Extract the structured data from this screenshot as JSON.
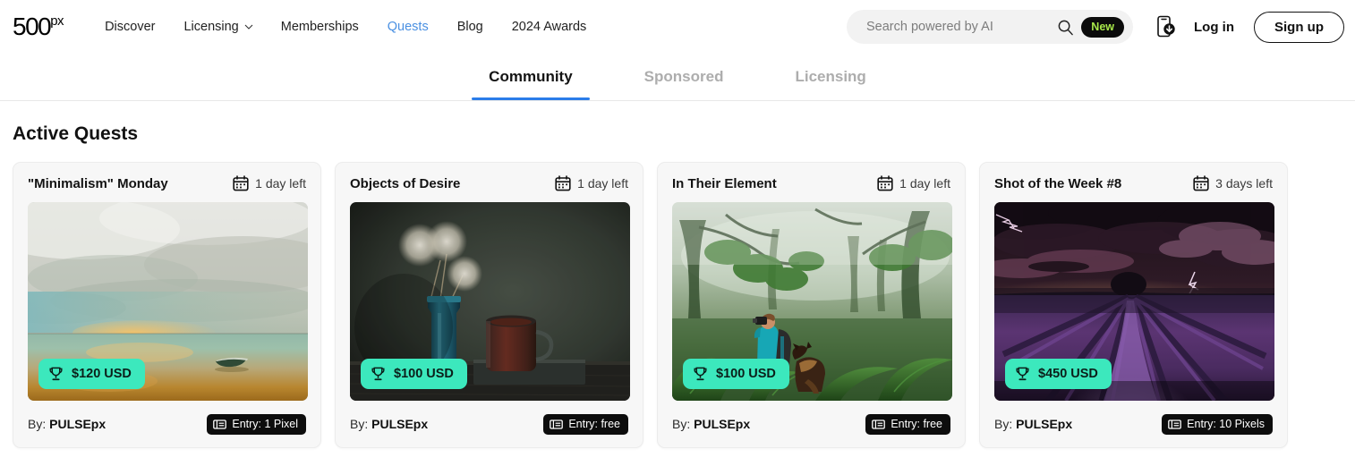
{
  "header": {
    "logo": {
      "num": "500",
      "px": "px"
    },
    "nav": [
      {
        "label": "Discover",
        "active": false,
        "caret": false
      },
      {
        "label": "Licensing",
        "active": false,
        "caret": true
      },
      {
        "label": "Memberships",
        "active": false,
        "caret": false
      },
      {
        "label": "Quests",
        "active": true,
        "caret": false
      },
      {
        "label": "Blog",
        "active": false,
        "caret": false
      },
      {
        "label": "2024 Awards",
        "active": false,
        "caret": false
      }
    ],
    "search": {
      "placeholder": "Search powered by AI",
      "value": "",
      "icon": "search-icon"
    },
    "new_badge": "New",
    "app_icon": "mobile-download-icon",
    "login_label": "Log in",
    "signup_label": "Sign up",
    "accent_blue": "#4a90e2",
    "new_badge_green": "#a8e84a"
  },
  "tabs": [
    {
      "label": "Community",
      "active": true
    },
    {
      "label": "Sponsored",
      "active": false
    },
    {
      "label": "Licensing",
      "active": false
    }
  ],
  "tab_underline_color": "#2b7de9",
  "section": {
    "title": "Active Quests"
  },
  "prize_badge_color": "#3ce8bd",
  "cards": [
    {
      "title": "\"Minimalism\" Monday",
      "days_left": "1 day left",
      "prize": "$120 USD",
      "by_label": "By:",
      "author": "PULSEpx",
      "entry": "Entry: 1 Pixel",
      "photo_alt": "minimalist-seascape-boat"
    },
    {
      "title": "Objects of Desire",
      "days_left": "1 day left",
      "prize": "$100 USD",
      "by_label": "By:",
      "author": "PULSEpx",
      "entry": "Entry: free",
      "photo_alt": "dark-still-life-dandelions-mug"
    },
    {
      "title": "In Their Element",
      "days_left": "1 day left",
      "prize": "$100 USD",
      "by_label": "By:",
      "author": "PULSEpx",
      "entry": "Entry: free",
      "photo_alt": "misty-forest-photographer-dog"
    },
    {
      "title": "Shot of the Week #8",
      "days_left": "3 days left",
      "prize": "$450 USD",
      "by_label": "By:",
      "author": "PULSEpx",
      "entry": "Entry: 10 Pixels",
      "photo_alt": "lavender-field-lightning-storm"
    }
  ]
}
